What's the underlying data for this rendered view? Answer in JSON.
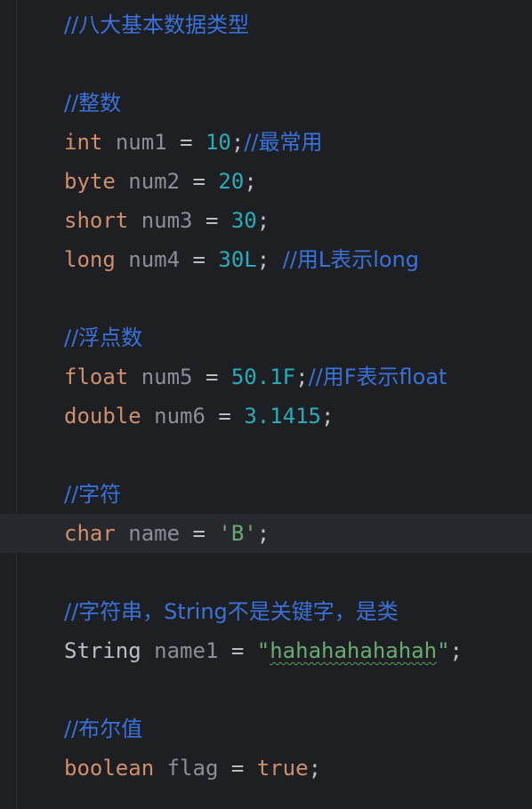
{
  "editor": {
    "lines": {
      "c_types": "//八大基本数据类型",
      "c_int": "//整数",
      "l1_kw": "int",
      "l1_var": "num1",
      "l1_eq": "=",
      "l1_val": "10",
      "l1_semi": ";",
      "l1_cm": "//最常用",
      "l2_kw": "byte",
      "l2_var": "num2",
      "l2_eq": "=",
      "l2_val": "20",
      "l2_semi": ";",
      "l3_kw": "short",
      "l3_var": "num3",
      "l3_eq": "=",
      "l3_val": "30",
      "l3_semi": ";",
      "l4_kw": "long",
      "l4_var": "num4",
      "l4_eq": "=",
      "l4_val": "30L",
      "l4_semi": ";",
      "l4_cm": "//用L表示long",
      "c_float": "//浮点数",
      "l5_kw": "float",
      "l5_var": "num5",
      "l5_eq": "=",
      "l5_val": "50.1F",
      "l5_semi": ";",
      "l5_cm": "//用F表示float",
      "l6_kw": "double",
      "l6_var": "num6",
      "l6_eq": "=",
      "l6_val": "3.1415",
      "l6_semi": ";",
      "c_char": "//字符",
      "l7_kw": "char",
      "l7_var": "name",
      "l7_eq": "=",
      "l7_val": "'B'",
      "l7_semi": ";",
      "c_string": "//字符串，String不是关键字，是类",
      "l8_type": "String",
      "l8_var": "name1",
      "l8_eq": "=",
      "l8_q1": "\"",
      "l8_val": "hahahahahahah",
      "l8_q2": "\"",
      "l8_semi": ";",
      "c_bool": "//布尔值",
      "l9_kw": "boolean",
      "l9_var": "flag",
      "l9_eq": "=",
      "l9_val": "true",
      "l9_semi": ";"
    }
  }
}
